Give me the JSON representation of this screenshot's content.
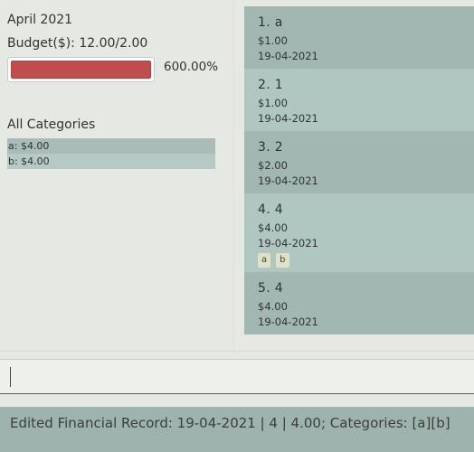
{
  "summary": {
    "month": "April 2021",
    "budget_text": "Budget($): 12.00/2.00",
    "progress_fraction": 1.0,
    "percent_text": "600.00%",
    "progress_color": "#bf4d4d"
  },
  "categories": {
    "title": "All Categories",
    "items": [
      "a: $4.00",
      "b: $4.00"
    ]
  },
  "records": [
    {
      "title": "1.  a",
      "amount": "$1.00",
      "date": "19-04-2021",
      "tags": []
    },
    {
      "title": "2.  1",
      "amount": "$1.00",
      "date": "19-04-2021",
      "tags": []
    },
    {
      "title": "3.  2",
      "amount": "$2.00",
      "date": "19-04-2021",
      "tags": []
    },
    {
      "title": "4.  4",
      "amount": "$4.00",
      "date": "19-04-2021",
      "tags": [
        "a",
        "b"
      ]
    },
    {
      "title": "5.  4",
      "amount": "$4.00",
      "date": "19-04-2021",
      "tags": []
    }
  ],
  "command": {
    "value": "",
    "placeholder": ""
  },
  "result": {
    "text": "Edited Financial Record: 19-04-2021 | 4 | 4.00; Categories: [a][b]"
  }
}
